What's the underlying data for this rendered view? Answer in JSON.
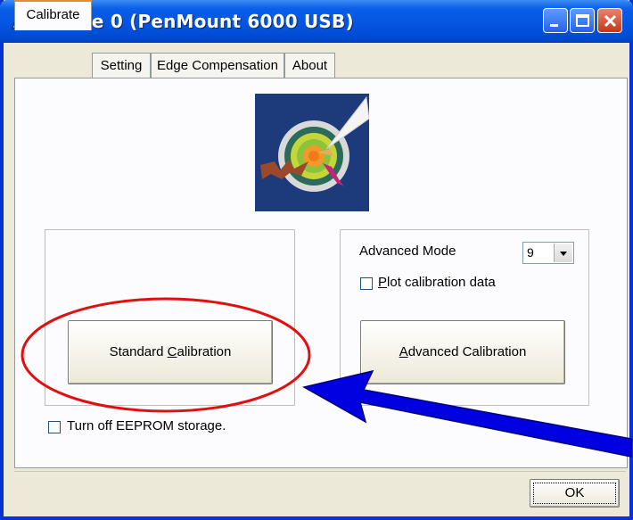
{
  "window": {
    "title": "Device 0 (PenMount 6000 USB)",
    "icon": "pencil-icon",
    "controls": [
      "minimize-icon",
      "maximize-icon",
      "close-icon"
    ]
  },
  "tabs": [
    {
      "label": "Calibrate",
      "active": true
    },
    {
      "label": "Setting",
      "active": false
    },
    {
      "label": "Edge Compensation",
      "active": false
    },
    {
      "label": "About",
      "active": false
    }
  ],
  "calibrate": {
    "standard_button": {
      "pre": "Standard ",
      "accel": "C",
      "post": "alibration"
    },
    "advanced_mode_label": "Advanced Mode",
    "advanced_mode_value": "9",
    "plot_checkbox": {
      "accel": "P",
      "rest": "lot calibration data",
      "checked": false
    },
    "advanced_button": {
      "accel": "A",
      "rest": "dvanced Calibration"
    },
    "eeprom_checkbox": {
      "label": "Turn off EEPROM storage.",
      "checked": false
    }
  },
  "footer": {
    "ok_label": "OK"
  },
  "annotations": {
    "circle_color": "#e01010",
    "arrow_color": "#0000e0"
  }
}
